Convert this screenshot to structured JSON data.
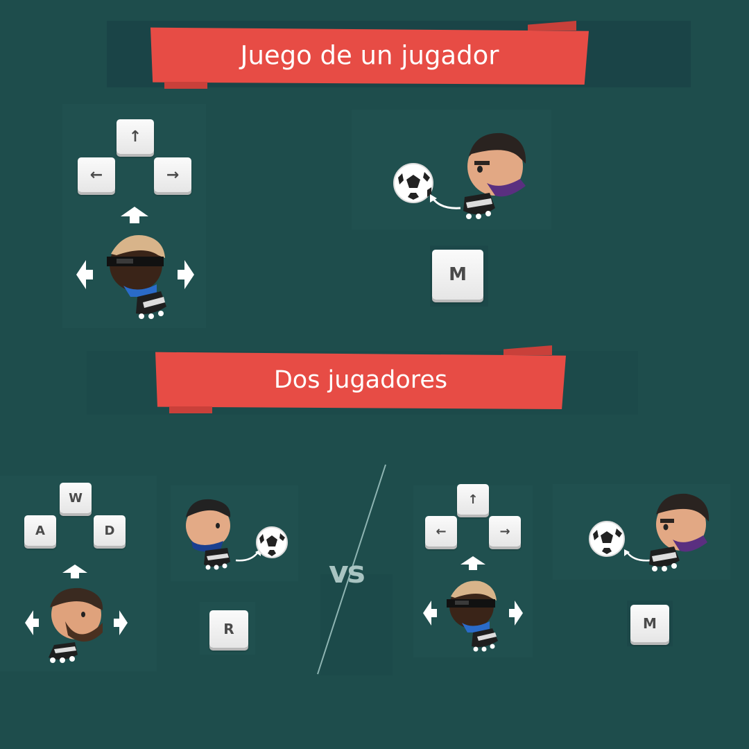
{
  "section_single": {
    "title": "Juego de un jugador"
  },
  "section_two": {
    "title": "Dos jugadores"
  },
  "keys": {
    "up": "↑",
    "left": "←",
    "right": "→",
    "w": "W",
    "a": "A",
    "d": "D",
    "m": "M",
    "r": "R"
  },
  "vs_label": "vs",
  "colors": {
    "background": "#1e4d4c",
    "ribbon": "#e74c45",
    "key": "#f2f2f2"
  }
}
